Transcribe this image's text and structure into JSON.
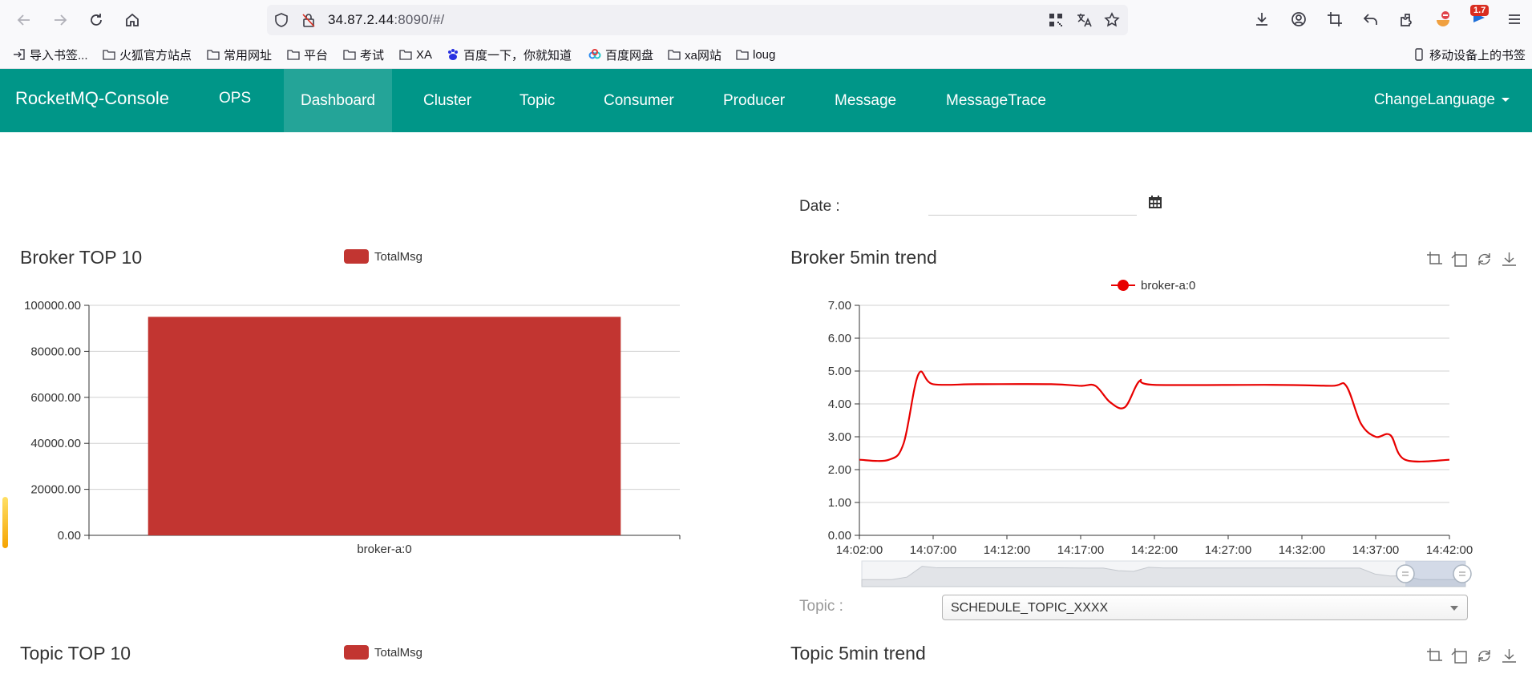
{
  "browser": {
    "url_host": "34.87.2.44",
    "url_rest": ":8090/#/",
    "ext_badge": "1.7",
    "bookmarks": [
      {
        "label": "导入书签...",
        "icon": "import-icon"
      },
      {
        "label": "火狐官方站点",
        "icon": "folder-icon"
      },
      {
        "label": "常用网址",
        "icon": "folder-icon"
      },
      {
        "label": "平台",
        "icon": "folder-icon"
      },
      {
        "label": "考试",
        "icon": "folder-icon"
      },
      {
        "label": "XA",
        "icon": "folder-icon"
      },
      {
        "label": "百度一下，你就知道",
        "icon": "baidu-icon"
      },
      {
        "label": "百度网盘",
        "icon": "baidu-pan-icon"
      },
      {
        "label": "xa网站",
        "icon": "folder-icon"
      },
      {
        "label": "loug",
        "icon": "folder-icon"
      }
    ],
    "mobile_bookmarks": "移动设备上的书签"
  },
  "navbar": {
    "brand": "RocketMQ-Console",
    "items": [
      "OPS",
      "Dashboard",
      "Cluster",
      "Topic",
      "Consumer",
      "Producer",
      "Message",
      "MessageTrace"
    ],
    "active": "Dashboard",
    "change_language": "ChangeLanguage"
  },
  "filters": {
    "date_label": "Date :",
    "date_value": "",
    "topic_label": "Topic :",
    "topic_value": "SCHEDULE_TOPIC_XXXX"
  },
  "panels": {
    "broker_top": {
      "title": "Broker TOP 10",
      "legend": "TotalMsg"
    },
    "broker_trend": {
      "title": "Broker 5min trend",
      "legend": "broker-a:0"
    },
    "topic_top": {
      "title": "Topic TOP 10",
      "legend": "TotalMsg"
    },
    "topic_trend": {
      "title": "Topic 5min trend"
    }
  },
  "colors": {
    "nav_bg": "#009688",
    "bar": "#c23531",
    "line": "#e80000"
  },
  "chart_data": [
    {
      "type": "bar",
      "title": "Broker TOP 10",
      "legend": [
        "TotalMsg"
      ],
      "categories": [
        "broker-a:0"
      ],
      "series": [
        {
          "name": "TotalMsg",
          "values": [
            95000
          ]
        }
      ],
      "ylim": [
        0,
        100000
      ],
      "yticks": [
        "0.00",
        "20000.00",
        "40000.00",
        "60000.00",
        "80000.00",
        "100000.00"
      ],
      "grid": true
    },
    {
      "type": "line",
      "title": "Broker 5min trend",
      "legend": [
        "broker-a:0"
      ],
      "xticks": [
        "14:02:00",
        "14:07:00",
        "14:12:00",
        "14:17:00",
        "14:22:00",
        "14:27:00",
        "14:32:00",
        "14:37:00",
        "14:42:00"
      ],
      "yticks": [
        "0.00",
        "1.00",
        "2.00",
        "3.00",
        "4.00",
        "5.00",
        "6.00",
        "7.00"
      ],
      "ylim": [
        0,
        7
      ],
      "xlim": [
        "14:02:00",
        "14:42:00"
      ],
      "grid": true,
      "series": [
        {
          "name": "broker-a:0",
          "points": [
            [
              "14:02:00",
              2.3
            ],
            [
              "14:04:00",
              2.3
            ],
            [
              "14:05:00",
              2.8
            ],
            [
              "14:06:00",
              4.9
            ],
            [
              "14:07:00",
              4.6
            ],
            [
              "14:10:00",
              4.6
            ],
            [
              "14:15:00",
              4.6
            ],
            [
              "14:17:00",
              4.55
            ],
            [
              "14:18:00",
              4.55
            ],
            [
              "14:19:00",
              4.05
            ],
            [
              "14:20:00",
              3.9
            ],
            [
              "14:21:00",
              4.7
            ],
            [
              "14:22:00",
              4.58
            ],
            [
              "14:30:00",
              4.58
            ],
            [
              "14:34:00",
              4.55
            ],
            [
              "14:35:00",
              4.55
            ],
            [
              "14:36:00",
              3.4
            ],
            [
              "14:37:00",
              3.0
            ],
            [
              "14:38:00",
              3.05
            ],
            [
              "14:39:00",
              2.3
            ],
            [
              "14:42:00",
              2.3
            ]
          ]
        }
      ]
    }
  ]
}
